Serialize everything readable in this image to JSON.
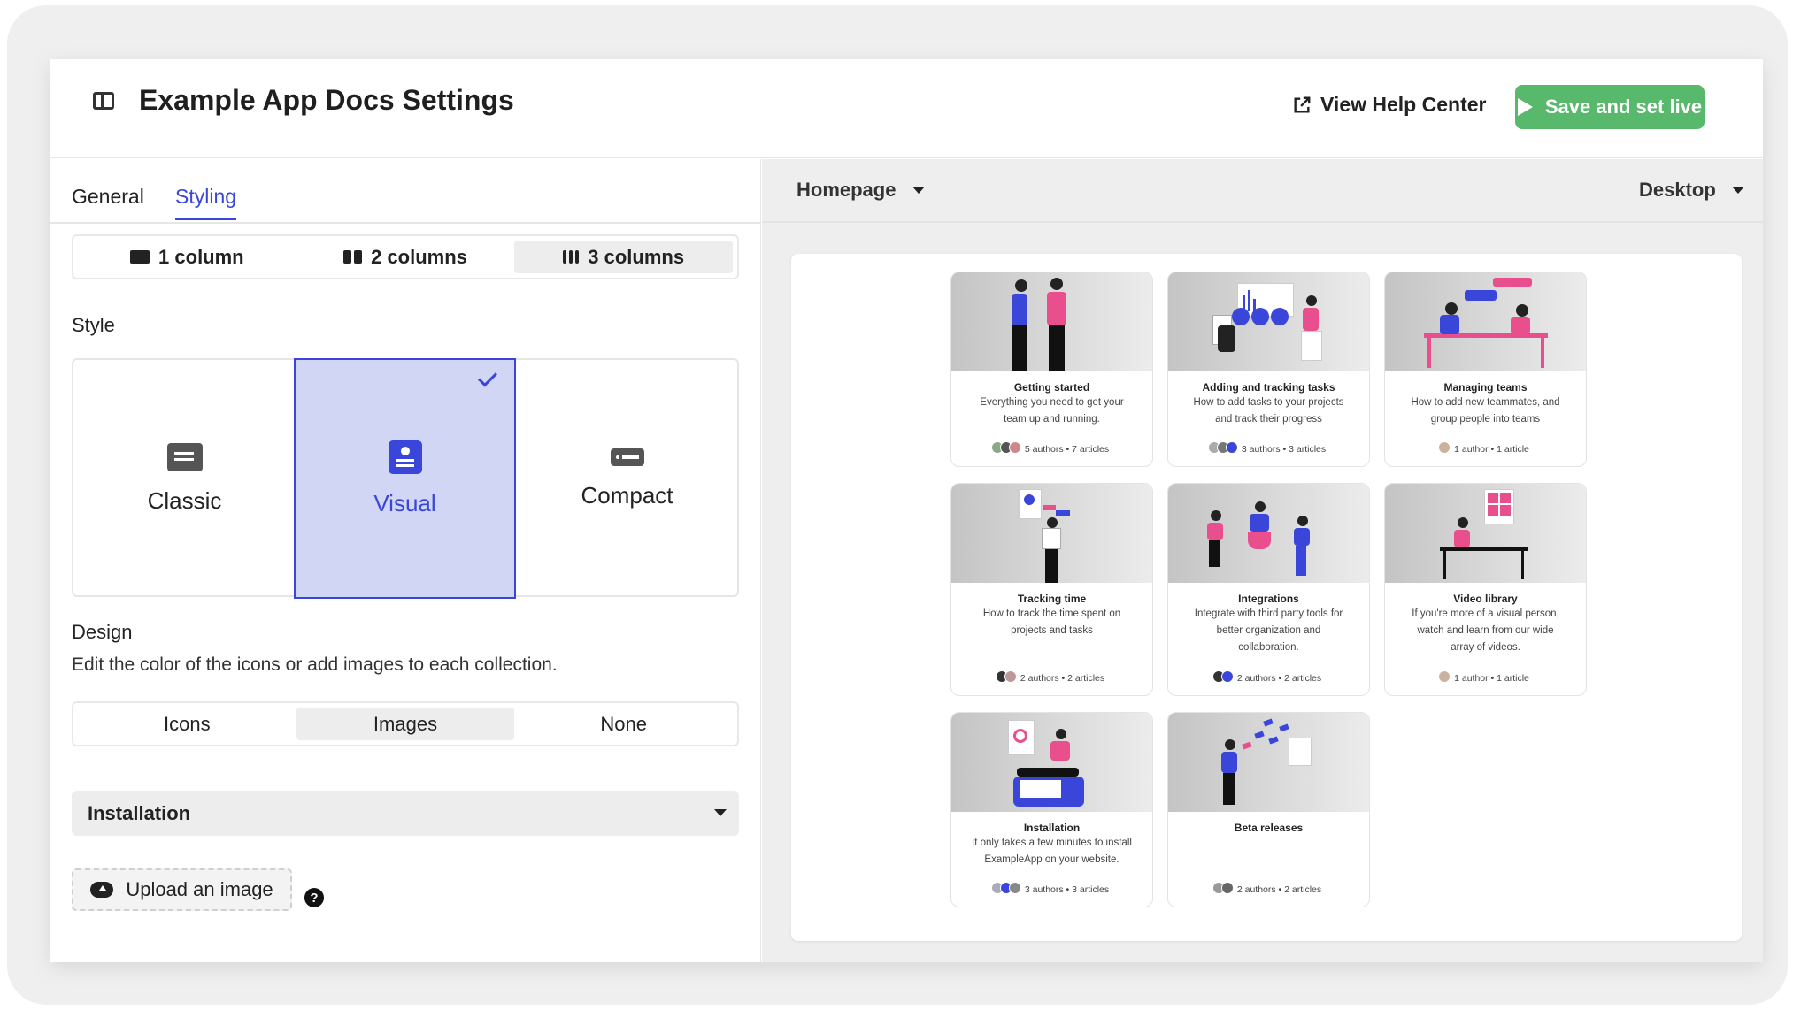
{
  "header": {
    "title": "Example App Docs Settings",
    "view_help": "View Help Center",
    "save": "Save and set live"
  },
  "tabs": [
    {
      "label": "General"
    },
    {
      "label": "Styling"
    }
  ],
  "columns": [
    {
      "label": "1 column"
    },
    {
      "label": "2 columns"
    },
    {
      "label": "3 columns",
      "selected": true
    }
  ],
  "style": {
    "label": "Style",
    "options": [
      {
        "label": "Classic"
      },
      {
        "label": "Visual",
        "selected": true
      },
      {
        "label": "Compact"
      }
    ]
  },
  "design": {
    "label": "Design",
    "description": "Edit the color of the icons or add images to each collection.",
    "options": [
      {
        "label": "Icons"
      },
      {
        "label": "Images",
        "selected": true
      },
      {
        "label": "None"
      }
    ],
    "collection_select": "Installation",
    "upload": "Upload an image",
    "help": "?"
  },
  "preview": {
    "page_select": "Homepage",
    "device_select": "Desktop",
    "accent": "#3a46d9",
    "pink": "#e84f8c",
    "cards": [
      {
        "title": "Getting started",
        "desc": "Everything you need to get your team up and running.",
        "meta": "5 authors  •  7 articles"
      },
      {
        "title": "Adding and tracking tasks",
        "desc": "How to add tasks to your projects and track their progress",
        "meta": "3 authors  •  3 articles"
      },
      {
        "title": "Managing teams",
        "desc": "How to add new teammates, and group people into teams",
        "meta": "1 author  •  1 article"
      },
      {
        "title": "Tracking time",
        "desc": "How to track the time spent on projects and tasks",
        "meta": "2 authors  •  2 articles"
      },
      {
        "title": "Integrations",
        "desc": "Integrate with third party tools for better organization and collaboration.",
        "meta": "2 authors  •  2 articles"
      },
      {
        "title": "Video library",
        "desc": "If you're more of a visual person, watch and learn from our wide array of videos.",
        "meta": "1 author  •  1 article"
      },
      {
        "title": "Installation",
        "desc": "It only takes a few minutes to install ExampleApp on your website.",
        "meta": "3 authors  •  3 articles"
      },
      {
        "title": "Beta releases",
        "desc": "",
        "meta": "2 authors  •  2 articles"
      }
    ]
  }
}
